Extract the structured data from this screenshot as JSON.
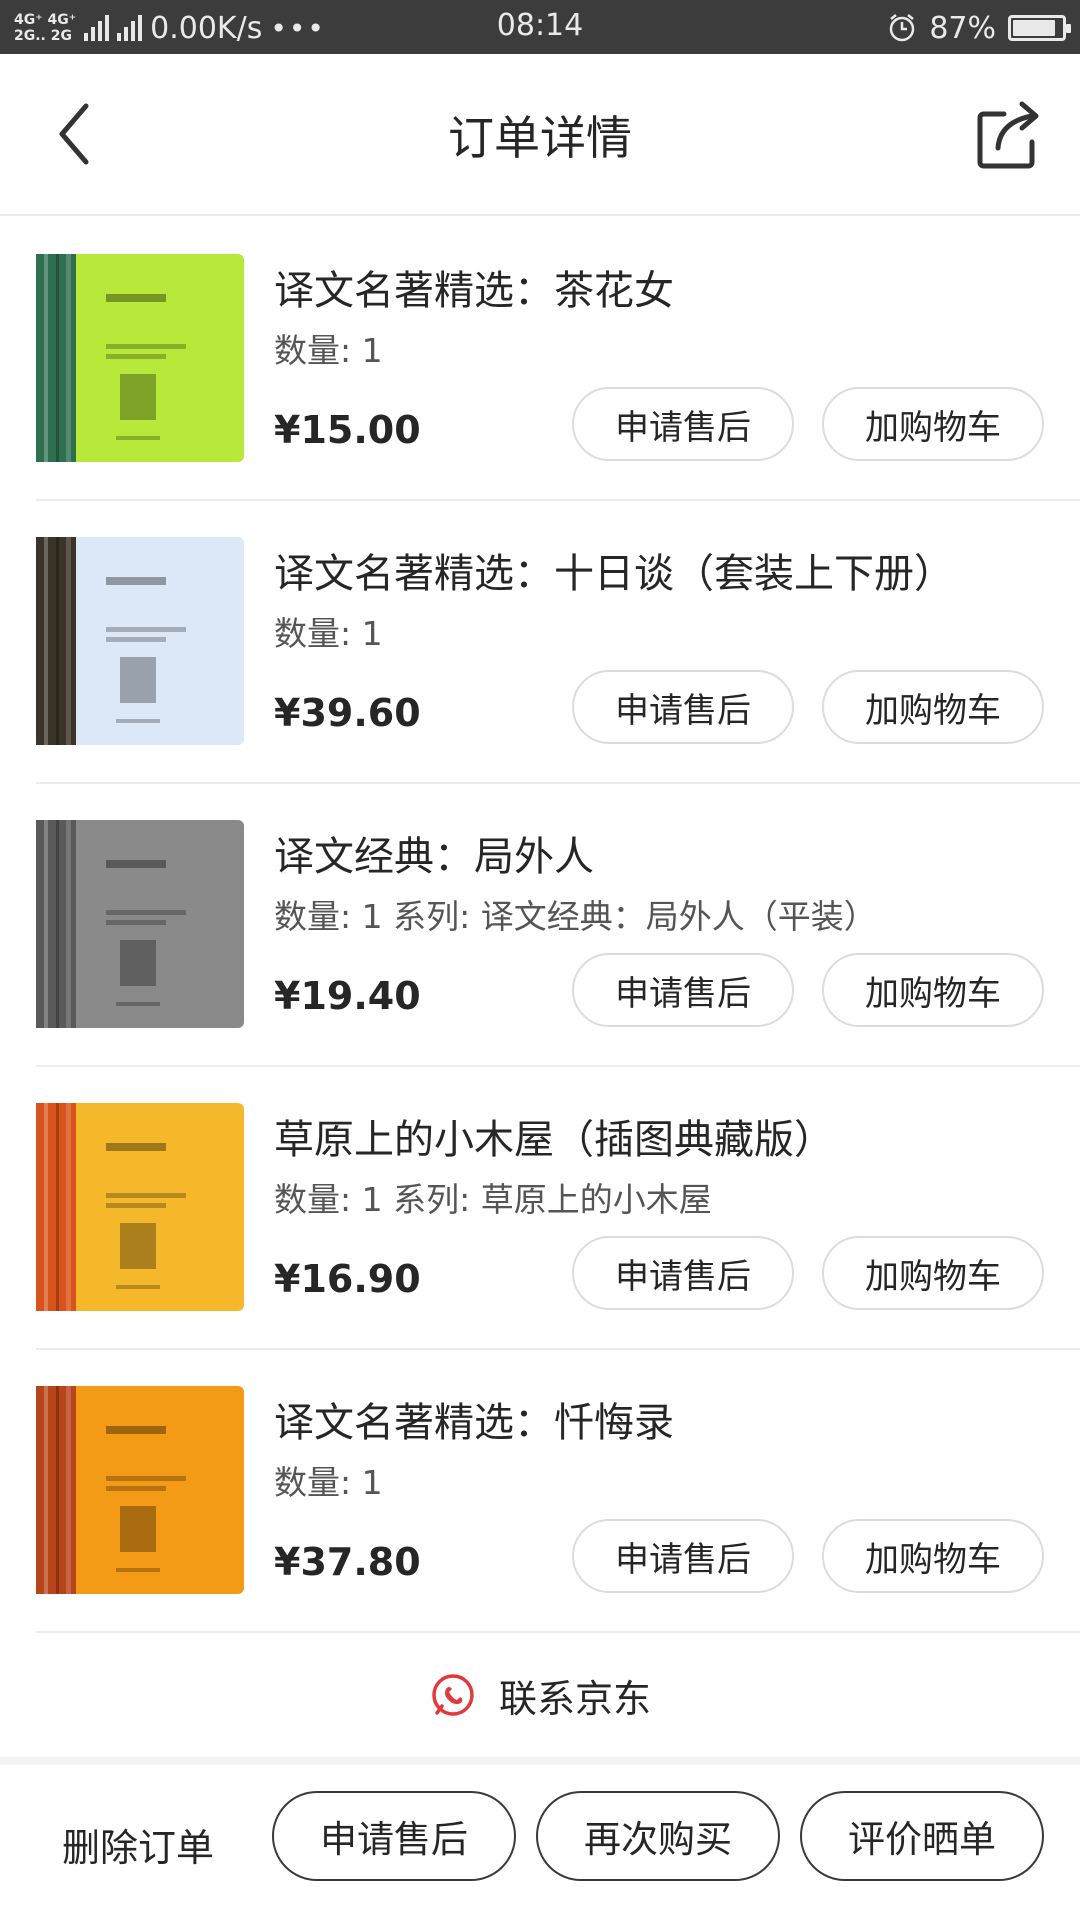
{
  "status_bar": {
    "network_top": "4G⁺ 4G⁺",
    "network_bottom": "2G.. 2G",
    "speed": "0.00K/s",
    "dots": "•••",
    "time": "08:14",
    "battery": "87%",
    "battery_level": 0.87
  },
  "header": {
    "title": "订单详情",
    "back_icon": "chevron-left-icon",
    "share_icon": "share-icon"
  },
  "items": [
    {
      "title": "译文名著精选：茶花女",
      "meta": "数量: 1",
      "price": "¥15.00",
      "after_sale_label": "申请售后",
      "add_cart_label": "加购物车",
      "cover_color": "#b7e83a",
      "spine_color": "#2f6f4f"
    },
    {
      "title": "译文名著精选：十日谈（套装上下册）",
      "meta": "数量: 1",
      "price": "¥39.60",
      "after_sale_label": "申请售后",
      "add_cart_label": "加购物车",
      "cover_color": "#dce8f6",
      "spine_color": "#3a3327"
    },
    {
      "title": "译文经典：局外人",
      "meta": "数量: 1 系列: 译文经典：局外人（平装）",
      "price": "¥19.40",
      "after_sale_label": "申请售后",
      "add_cart_label": "加购物车",
      "cover_color": "#8a8a8a",
      "spine_color": "#5a5a5a"
    },
    {
      "title": "草原上的小木屋（插图典藏版）",
      "meta": "数量: 1 系列: 草原上的小木屋",
      "price": "¥16.90",
      "after_sale_label": "申请售后",
      "add_cart_label": "加购物车",
      "cover_color": "#f5b82a",
      "spine_color": "#d9541c"
    },
    {
      "title": "译文名著精选：忏悔录",
      "meta": "数量: 1",
      "price": "¥37.80",
      "after_sale_label": "申请售后",
      "add_cart_label": "加购物车",
      "cover_color": "#f39a16",
      "spine_color": "#b8451a"
    }
  ],
  "contact": {
    "label": "联系京东",
    "icon": "phone-chat-icon",
    "icon_color": "#e4393c"
  },
  "bottom_bar": {
    "delete_label": "删除订单",
    "after_sale_label": "申请售后",
    "rebuy_label": "再次购买",
    "review_label": "评价晒单"
  }
}
